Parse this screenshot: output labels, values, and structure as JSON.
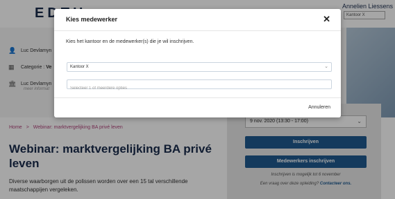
{
  "header": {
    "logo": "EDTH",
    "user_name": "Annelien Liessens",
    "office_selector": "Kantoor X"
  },
  "info": {
    "row1": "Luc Devlamyn",
    "row2_label": "Categorie :",
    "row2_value": "Ve",
    "row3": "Luc Devlamyn",
    "row3_sub": "meer informat"
  },
  "breadcrumb": {
    "home": "Home",
    "separator": ">",
    "current": "Webinar: marktvergelijking BA privé leven"
  },
  "course": {
    "title": "Webinar: marktvergelijking BA privé leven",
    "description": "Diverse waarborgen uit de polissen worden over een 15 tal verschillende maatschappijen vergeleken."
  },
  "sidebar": {
    "date_option": "9 nov. 2020 (13:30 - 17:00)",
    "enroll_label": "Inschrijven",
    "enroll_colleagues_label": "Medewerkers inschrijven",
    "deadline_note": "Inschrijven is mogelijk tot 6 november",
    "question_text": "Een vraag over deze opleiding?",
    "contact_link": "Contacteer ons."
  },
  "modal": {
    "title": "Kies medewerker",
    "close": "✕",
    "intro": "Kies het kantoor en de medewerker(s) die je wil inschrijven.",
    "office_value": "Kantoor X",
    "employees_placeholder": "Selecteer 1 of meerdere opties",
    "cancel_label": "Annuleren"
  },
  "colors": {
    "primary": "#1f5a8f",
    "accent": "#b0457b",
    "navy": "#1a2b4c"
  }
}
